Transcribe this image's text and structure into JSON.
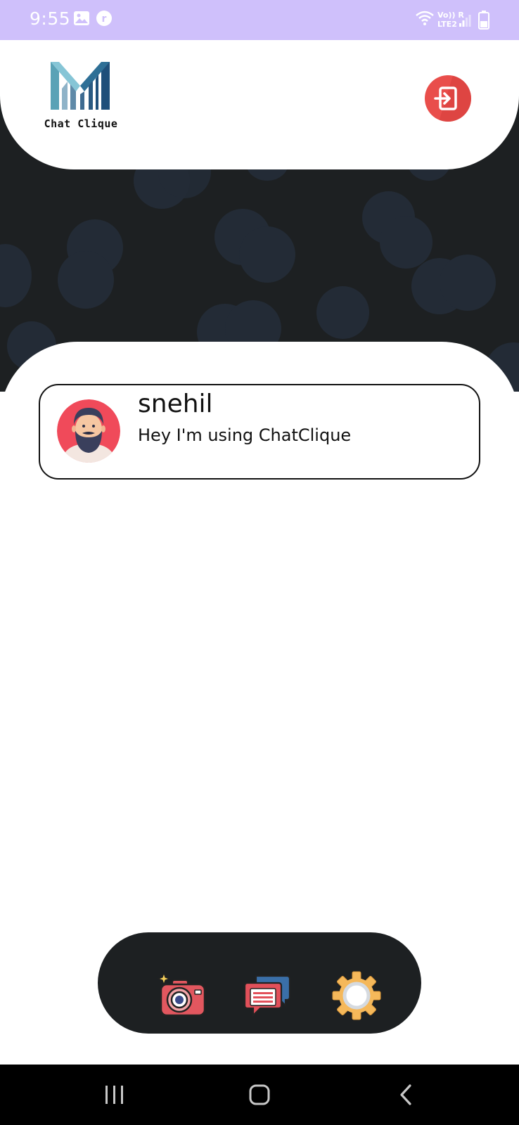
{
  "status_bar": {
    "time": "9:55",
    "network_label_top": "Vo)) R",
    "network_label_bottom": "LTE2",
    "icons": [
      "gallery-icon",
      "notification-app-icon",
      "wifi-icon",
      "signal-icon",
      "battery-icon"
    ]
  },
  "header": {
    "app_name": "Chat Clique",
    "logout_icon": "logout-icon"
  },
  "chats": [
    {
      "name": "snehil",
      "status": "Hey I'm using ChatClique",
      "avatar": "bearded-man-avatar"
    }
  ],
  "bottom_nav": {
    "items": [
      {
        "icon": "camera-icon"
      },
      {
        "icon": "chat-icon"
      },
      {
        "icon": "settings-gear-icon"
      }
    ]
  },
  "system_nav": {
    "items": [
      {
        "icon": "recent-apps-icon"
      },
      {
        "icon": "home-icon"
      },
      {
        "icon": "back-icon"
      }
    ]
  },
  "colors": {
    "status_bar": "#cfc0fb",
    "dark_background": "#1d2022",
    "pattern": "#232b36",
    "logout_red": "#e94e4b",
    "nav_bar": "#1d2022"
  }
}
